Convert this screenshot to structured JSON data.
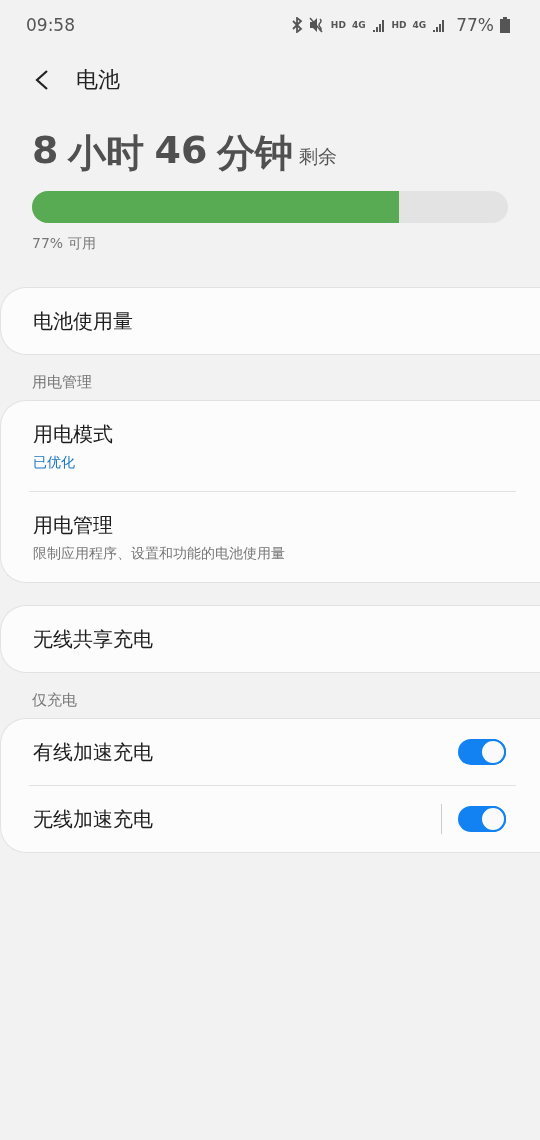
{
  "status_bar": {
    "time": "09:58",
    "hd_1": "HD",
    "net_1": "4G",
    "hd_2": "HD",
    "net_2": "4G",
    "battery": "77%"
  },
  "header": {
    "title": "电池"
  },
  "summary": {
    "time_parts": [
      "8",
      "小时",
      "46",
      "分钟"
    ],
    "suffix": "剩余",
    "level": 0.77,
    "available": "77% 可用"
  },
  "sections": [
    {
      "items": [
        {
          "kind": "link",
          "title": "电池使用量"
        }
      ]
    },
    {
      "label": "用电管理",
      "items": [
        {
          "kind": "link",
          "title": "用电模式",
          "subtitle": "已优化",
          "accent": true
        },
        {
          "kind": "link",
          "title": "用电管理",
          "subtitle": "限制应用程序、设置和功能的电池使用量",
          "accent": false
        }
      ]
    },
    {
      "items": [
        {
          "kind": "link",
          "title": "无线共享充电"
        }
      ]
    },
    {
      "label": "仅充电",
      "items": [
        {
          "kind": "toggle",
          "title": "有线加速充电",
          "on": true,
          "separator": false
        },
        {
          "kind": "toggle",
          "title": "无线加速充电",
          "on": true,
          "separator": true
        }
      ]
    }
  ]
}
